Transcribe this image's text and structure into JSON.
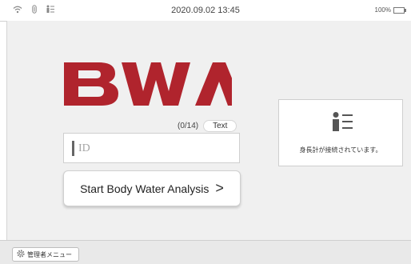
{
  "status_bar": {
    "datetime": "2020.09.02 13:45",
    "battery_text": "100%",
    "icons": [
      "wifi-icon",
      "bluetooth-icon",
      "height-sensor-icon",
      "battery-icon"
    ]
  },
  "brand": {
    "logo_text": "BWA",
    "logo_color": "#b0242d"
  },
  "id_entry": {
    "counter": "(0/14)",
    "mode_button": "Text",
    "placeholder": "ID"
  },
  "start_button": {
    "label": "Start Body Water Analysis",
    "chevron": ">"
  },
  "height_meter": {
    "icon": "height-meter-icon",
    "status": "身長計が接続されています。"
  },
  "bottom_bar": {
    "admin_label": "管理者メニュー",
    "admin_icon": "gear-icon"
  }
}
